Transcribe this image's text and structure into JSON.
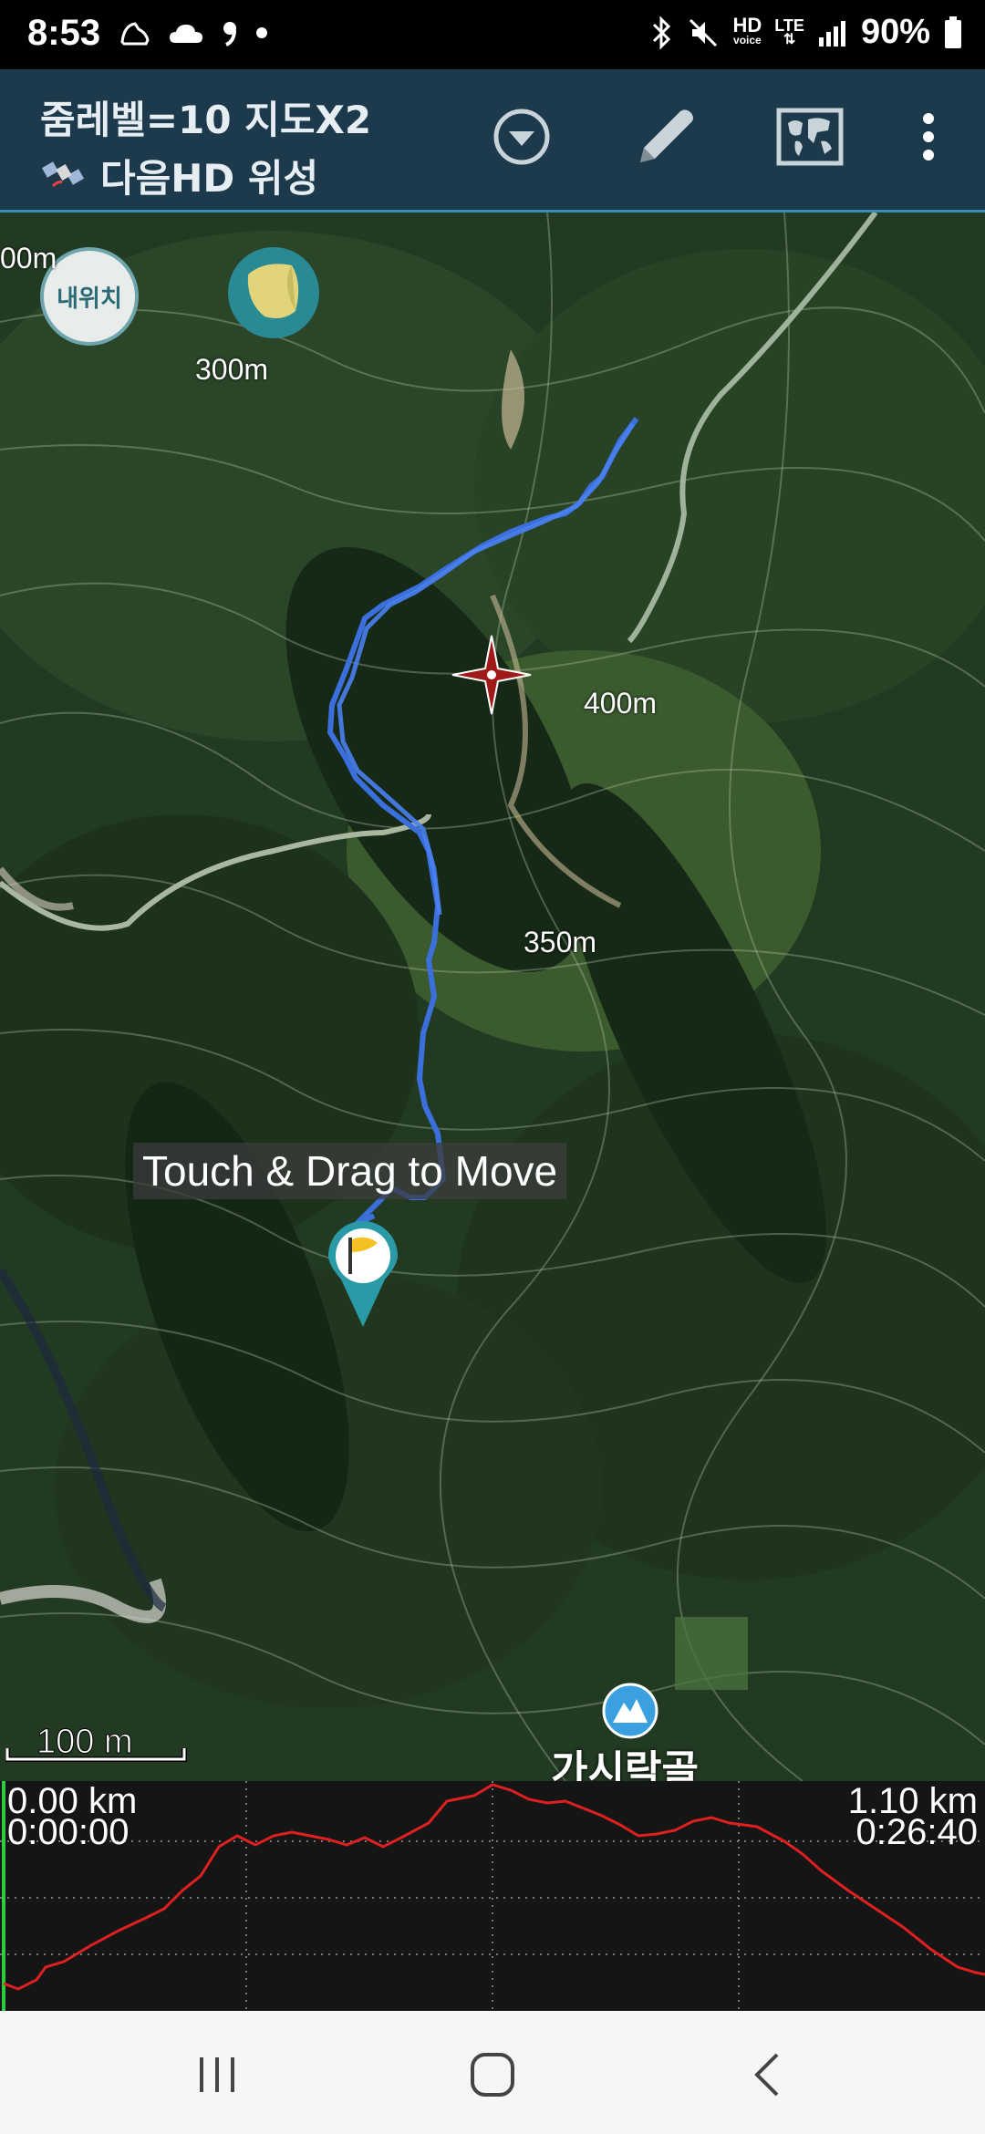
{
  "status_bar": {
    "time": "8:53",
    "battery": "90%",
    "hd_voice": "HD",
    "hd_voice_sub": "voice",
    "lte": "LTE"
  },
  "toolbar": {
    "zoom_title": "줌레벨=10 지도X2",
    "map_source": "다음HD 위성",
    "icons": [
      "dropdown-icon",
      "pencil-icon",
      "world-map-icon",
      "more-vert-icon"
    ]
  },
  "map": {
    "my_location_label": "내위치",
    "altitude_btn_label": "300m",
    "contour_labels": [
      "00m",
      "400m",
      "350m"
    ],
    "hint": "Touch & Drag to Move",
    "poi_name": "가시락골",
    "scale": "100 m"
  },
  "profile": {
    "start_distance": "0.00 km",
    "start_time": "0:00:00",
    "end_distance": "1.10 km",
    "end_time": "0:26:40",
    "colors": {
      "line": "#e02020",
      "cursor": "#2ecc40"
    }
  },
  "nav": {
    "icons": [
      "recent-apps-icon",
      "home-icon",
      "back-icon"
    ]
  },
  "colors": {
    "toolbar_bg": "#1c3a4b",
    "track": "#3a6fdc",
    "accent": "#3a8fb5"
  }
}
